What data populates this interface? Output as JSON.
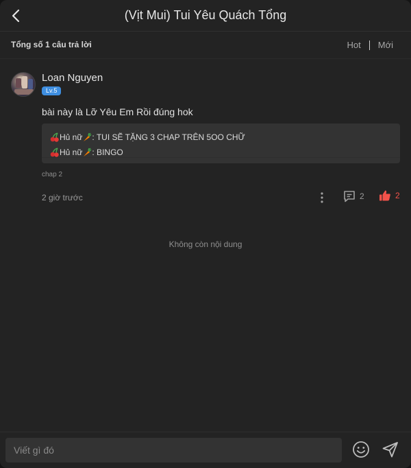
{
  "header": {
    "title": "(Vịt Mui) Tui Yêu Quách Tổng",
    "back_icon": "chevron-left-icon"
  },
  "subbar": {
    "total_label": "Tổng số 1 câu trả lời",
    "sort_hot": "Hot",
    "sort_new": "Mới"
  },
  "comment": {
    "username": "Loan Nguyen",
    "level": "Lv.5",
    "content": "bài này là Lỡ Yêu Em Rồi đúng hok",
    "quotes": [
      {
        "prefix": "Hủ nữ",
        "text": ": TUI SẼ TẶNG 3 CHAP TRÊN 5OO CHỮ"
      },
      {
        "prefix": "Hủ nữ",
        "text": ": BINGO"
      }
    ],
    "chapter": "chap 2",
    "time": "2 giờ trước",
    "reply_count": "2",
    "like_count": "2",
    "like_color": "#f2524a"
  },
  "end_text": "Không còn nội dung",
  "compose": {
    "placeholder": "Viết gì đó",
    "emoji_icon": "smiley-icon",
    "send_icon": "send-icon"
  }
}
